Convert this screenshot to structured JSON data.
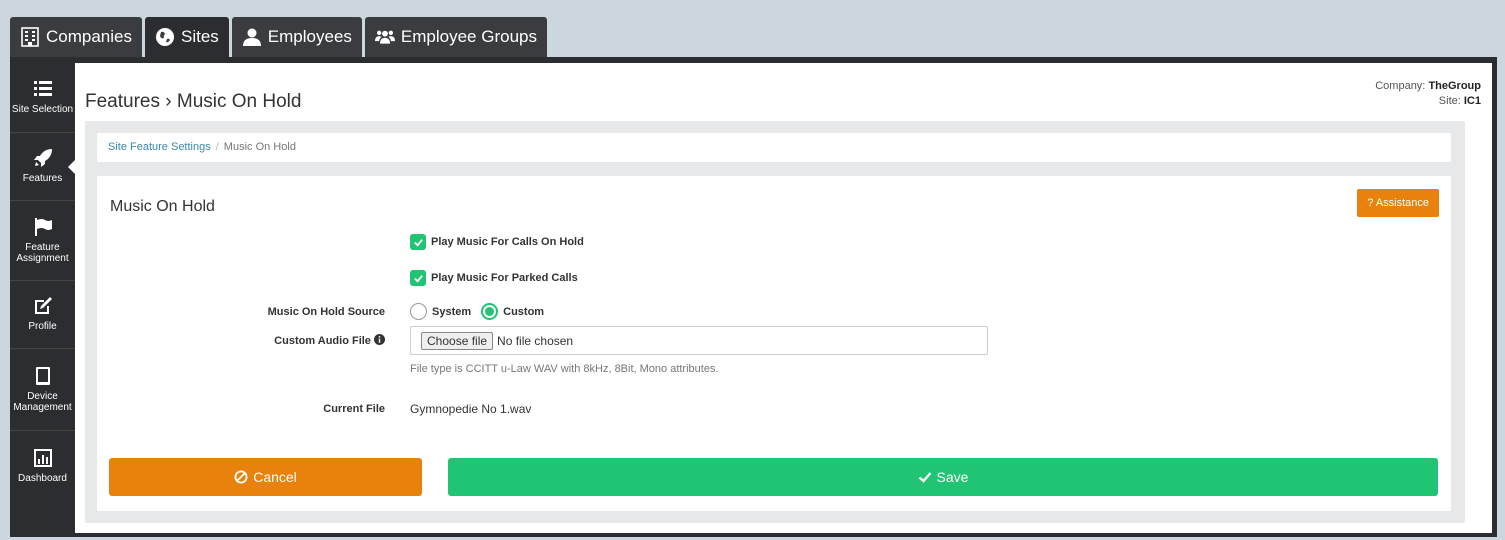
{
  "tabs": [
    {
      "label": "Companies",
      "icon": "building-icon"
    },
    {
      "label": "Sites",
      "icon": "globe-icon"
    },
    {
      "label": "Employees",
      "icon": "user-icon"
    },
    {
      "label": "Employee Groups",
      "icon": "users-icon"
    }
  ],
  "active_tab": "Sites",
  "sidenav": [
    {
      "label": "Site Selection",
      "icon": "list-icon"
    },
    {
      "label": "Features",
      "icon": "rocket-icon",
      "active": true
    },
    {
      "label": "Feature Assignment",
      "icon": "flag-icon"
    },
    {
      "label": "Profile",
      "icon": "edit-icon"
    },
    {
      "label": "Device Management",
      "icon": "tablet-icon"
    },
    {
      "label": "Dashboard",
      "icon": "bar-chart-icon"
    }
  ],
  "header": {
    "title": "Features › Music On Hold",
    "company_label": "Company:",
    "company_value": "TheGroup",
    "site_label": "Site:",
    "site_value": "IC1"
  },
  "breadcrumb": {
    "link": "Site Feature Settings",
    "separator": "/",
    "current": "Music On Hold"
  },
  "card": {
    "title": "Music On Hold",
    "assistance_label": "? Assistance"
  },
  "form": {
    "play_calls_on_hold": {
      "label": "Play Music For Calls On Hold",
      "checked": true
    },
    "play_parked_calls": {
      "label": "Play Music For Parked Calls",
      "checked": true
    },
    "source_label": "Music On Hold Source",
    "source_options": [
      "System",
      "Custom"
    ],
    "source_selected": "Custom",
    "custom_file_label": "Custom Audio File",
    "choose_file_label": "Choose file",
    "no_file_text": "No file chosen",
    "file_hint": "File type is CCITT u-Law WAV with 8kHz, 8Bit, Mono attributes.",
    "current_file_label": "Current File",
    "current_file_value": "Gymnopedie No 1.wav"
  },
  "buttons": {
    "cancel": "Cancel",
    "save": "Save"
  },
  "colors": {
    "accent_orange": "#e8820c",
    "accent_green": "#20c472",
    "nav_dark": "#2b2d31"
  }
}
